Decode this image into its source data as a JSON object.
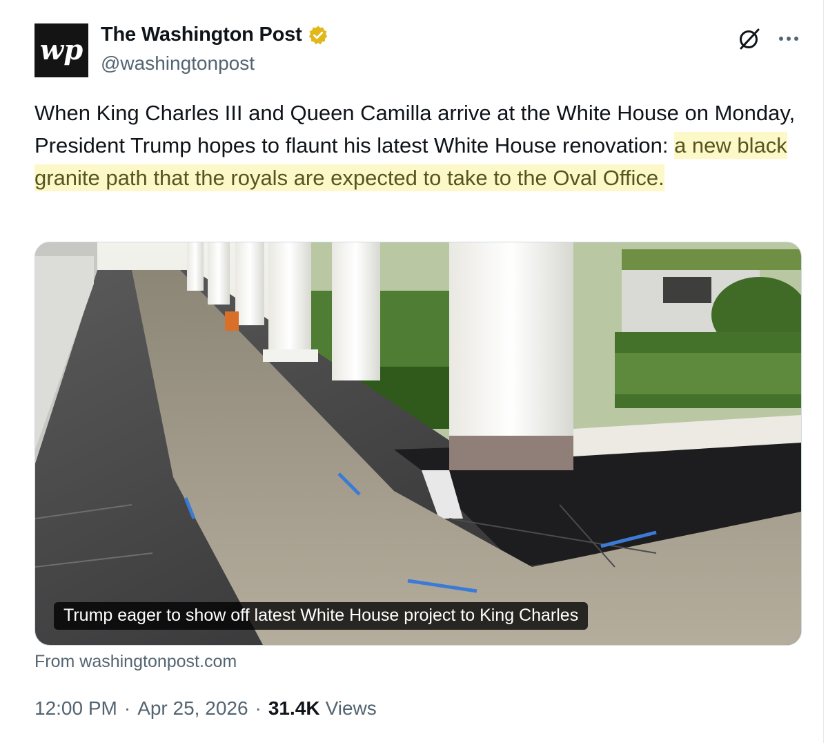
{
  "author": {
    "display_name": "The Washington Post",
    "handle": "@washingtonpost",
    "avatar_text": "wp",
    "verified_color": "#e2b719"
  },
  "icons": {
    "grok": "grok-icon",
    "more": "more-icon",
    "verified": "verified-badge-icon"
  },
  "tweet": {
    "text_plain": "When King Charles III and Queen Camilla arrive at the White House on Monday, President Trump hopes to flaunt his latest White House renovation: ",
    "text_highlighted": "a new black granite path that the royals are expected to take to the Oval Office.",
    "highlight_color": "#fdf8c8"
  },
  "card": {
    "title": "Trump eager to show off latest White House project to King Charles",
    "source": "From washingtonpost.com"
  },
  "meta": {
    "time": "12:00 PM",
    "date": "Apr 25, 2026",
    "views_count": "31.4K",
    "views_label": "Views",
    "separator": "·"
  }
}
